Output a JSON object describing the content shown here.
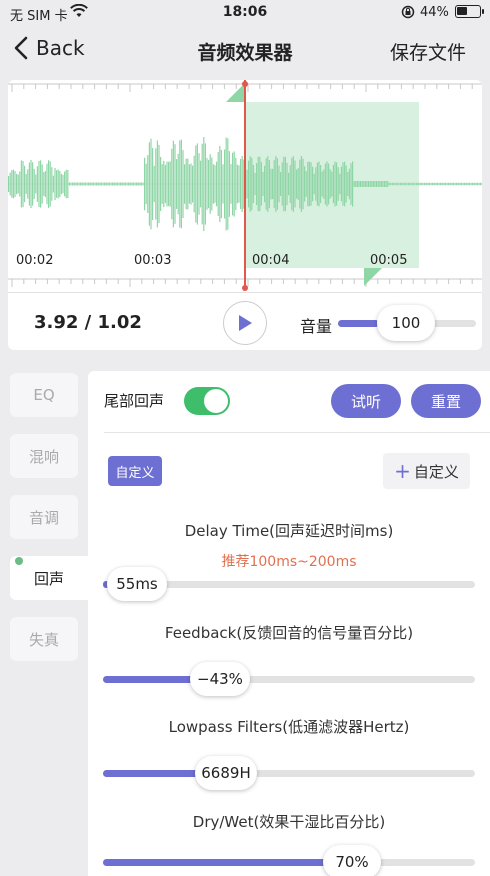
{
  "status_bar": {
    "carrier": "无 SIM 卡",
    "time": "18:06",
    "battery_percent": "44%"
  },
  "nav": {
    "back_label": "Back",
    "title": "音频效果器",
    "save_label": "保存文件"
  },
  "timeline": {
    "labels": [
      "00:02",
      "00:03",
      "00:04",
      "00:05"
    ]
  },
  "playback": {
    "position_text": "3.92 / 1.02",
    "volume_label": "音量",
    "volume_value": "100",
    "volume_level": 0.3
  },
  "tabs": [
    {
      "label": "EQ",
      "active": false
    },
    {
      "label": "混响",
      "active": false
    },
    {
      "label": "音调",
      "active": false
    },
    {
      "label": "回声",
      "active": true
    },
    {
      "label": "失真",
      "active": false
    }
  ],
  "echo_panel": {
    "tail_echo_label": "尾部回声",
    "tail_echo_enabled": true,
    "preview_button": "试听",
    "reset_button": "重置",
    "preset_chip": "自定义",
    "custom_button": "自定义",
    "params": [
      {
        "title": "Delay Time(回声延迟时间ms)",
        "hint": "推荐100ms~200ms",
        "value_text": "55ms",
        "level": 0.0
      },
      {
        "title": "Feedback(反馈回音的信号量百分比)",
        "value_text": "−43%",
        "level": 0.37
      },
      {
        "title": "Lowpass Filters(低通滤波器Hertz)",
        "value_text": "6689H",
        "level": 0.38
      },
      {
        "title": "Dry/Wet(效果干湿比百分比)",
        "value_text": "70%",
        "level": 0.65
      }
    ]
  },
  "colors": {
    "accent": "#6e6fd2",
    "waveform": "#8fd6a6",
    "selection": "#d8f0df",
    "playhead": "#e2574c",
    "toggle_on": "#3ebe6a",
    "hint": "#e07150"
  }
}
